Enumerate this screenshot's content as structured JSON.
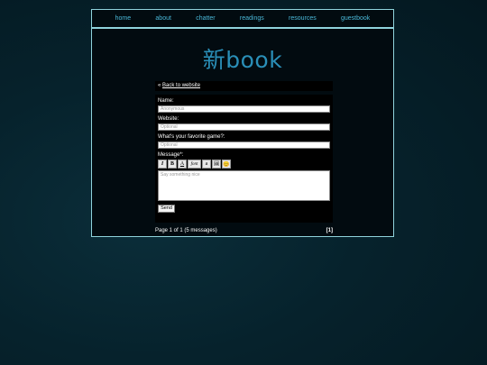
{
  "nav": {
    "items": [
      "home",
      "about",
      "chatter",
      "readings",
      "resources",
      "guestbook"
    ]
  },
  "logo": {
    "text": "新book"
  },
  "back": {
    "arrow": "«",
    "label": "Back to website"
  },
  "form": {
    "name_label": "Name:",
    "name_placeholder": "Anonymous",
    "website_label": "Website:",
    "website_placeholder": "Optional",
    "game_label": "What's your favorite game?:",
    "game_placeholder": "Optional",
    "message_label": "Message*:",
    "message_placeholder": "Say something nice",
    "send_label": "Send",
    "toolbar": [
      "I",
      "B",
      "A",
      "font",
      "a",
      "🖼",
      "😊"
    ]
  },
  "pager": {
    "summary": "Page 1 of 1 (5 messages)",
    "current": "[1]"
  }
}
